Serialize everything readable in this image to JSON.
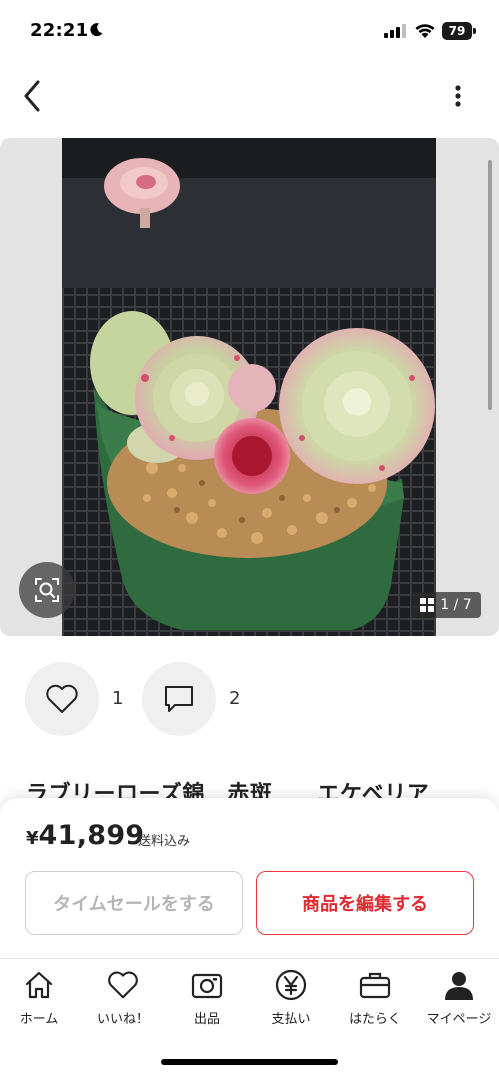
{
  "status_bar": {
    "time": "22:21",
    "battery": "79"
  },
  "photo": {
    "page_indicator": "1 / 7"
  },
  "actions": {
    "like_count": "1",
    "comment_count": "2"
  },
  "product": {
    "title": "ラブリーローズ錦　赤斑　　エケベリア",
    "price_symbol": "¥",
    "price": "41,899",
    "shipping_note": "送料込み"
  },
  "buttons": {
    "time_sale": "タイムセールをする",
    "edit_item": "商品を編集する"
  },
  "tab_bar": {
    "items": [
      {
        "label": "ホーム",
        "icon": "home-icon"
      },
      {
        "label": "いいね！",
        "icon": "heart-icon"
      },
      {
        "label": "出品",
        "icon": "camera-icon"
      },
      {
        "label": "支払い",
        "icon": "yen-icon"
      },
      {
        "label": "はたらく",
        "icon": "briefcase-icon"
      },
      {
        "label": "マイページ",
        "icon": "person-icon"
      }
    ]
  },
  "colors": {
    "accent_red": "#e02a30",
    "pot_green": "#2f6b3e"
  }
}
